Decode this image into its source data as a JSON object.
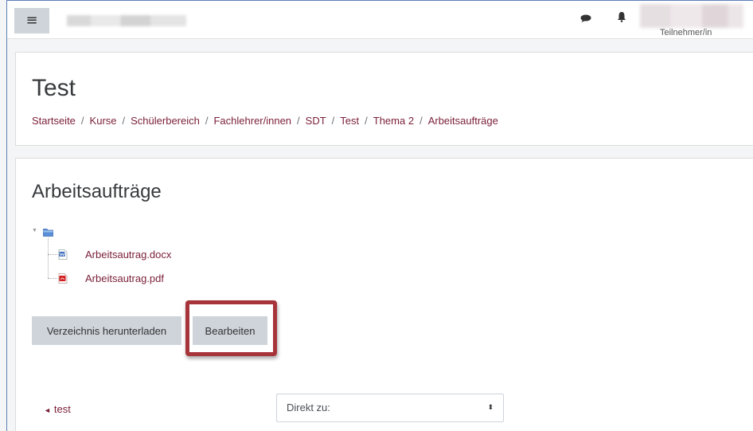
{
  "navbar": {
    "menu_icon": "hamburger-icon",
    "menu_glyph": "≡",
    "role": "Teilnehmer/in",
    "icons": [
      "chat-icon",
      "bell-icon"
    ]
  },
  "header": {
    "title": "Test",
    "breadcrumb": [
      "Startseite",
      "Kurse",
      "Schülerbereich",
      "Fachlehrer/innen",
      "SDT",
      "Test",
      "Thema 2",
      "Arbeitsaufträge"
    ],
    "separator": "/"
  },
  "main": {
    "title": "Arbeitsaufträge",
    "files": [
      {
        "name": "Arbeitsautrag.docx",
        "icon": "word-doc-icon"
      },
      {
        "name": "Arbeitsautrag.pdf",
        "icon": "pdf-icon"
      }
    ],
    "download_label": "Verzeichnis herunterladen",
    "edit_label": "Bearbeiten",
    "prev_link": "test",
    "prev_arrow": "◄",
    "jump_select": "Direkt zu:",
    "select_arrow": "⬍"
  },
  "colors": {
    "link": "#7a1f37",
    "button_bg": "#ced4da",
    "highlight": "#a8343b"
  }
}
